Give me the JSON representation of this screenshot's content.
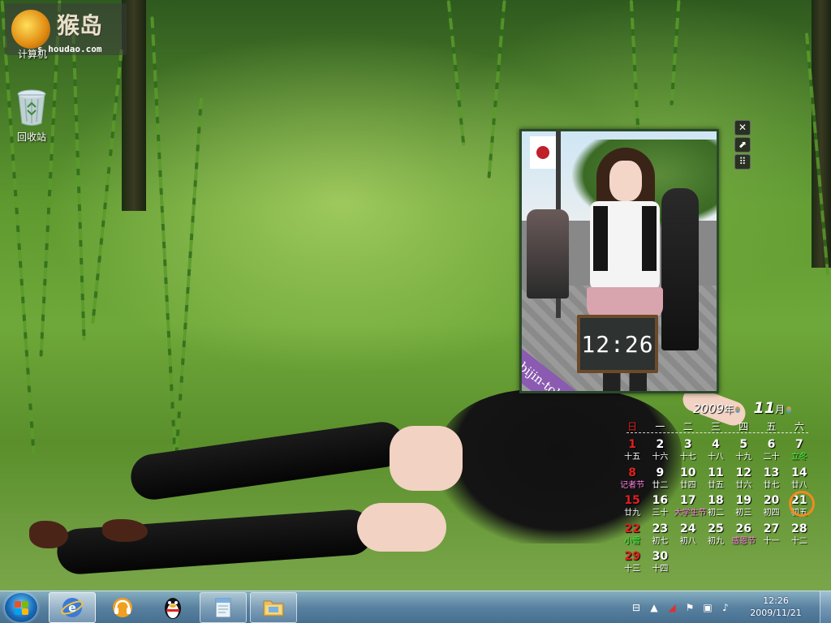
{
  "desktop": {
    "watermark": {
      "logo": "猴岛",
      "url": "s.houdao.com"
    },
    "icons": [
      {
        "label": "计算机",
        "icon": "computer-icon"
      },
      {
        "label": "回收站",
        "icon": "recycle-bin-icon"
      }
    ]
  },
  "bijin_gadget": {
    "time": "12:26",
    "ribbon": "bijin-tokei",
    "tools": {
      "close": "✕",
      "resize": "⬈",
      "drag": "⠿"
    }
  },
  "calendar": {
    "year": "2009",
    "year_suffix": "年",
    "month": "11",
    "month_suffix": "月",
    "weekdays": [
      "日",
      "一",
      "二",
      "三",
      "四",
      "五",
      "六"
    ],
    "today": 21,
    "weeks": [
      [
        {
          "d": "1",
          "l": "十五"
        },
        {
          "d": "2",
          "l": "十六"
        },
        {
          "d": "3",
          "l": "十七"
        },
        {
          "d": "4",
          "l": "十八"
        },
        {
          "d": "5",
          "l": "十九"
        },
        {
          "d": "6",
          "l": "二十"
        },
        {
          "d": "7",
          "l": "立冬",
          "fest": "green"
        }
      ],
      [
        {
          "d": "8",
          "l": "记者节",
          "fest": "pink"
        },
        {
          "d": "9",
          "l": "廿二"
        },
        {
          "d": "10",
          "l": "廿四"
        },
        {
          "d": "11",
          "l": "廿五"
        },
        {
          "d": "12",
          "l": "廿六"
        },
        {
          "d": "13",
          "l": "廿七"
        },
        {
          "d": "14",
          "l": "廿八"
        }
      ],
      [
        {
          "d": "15",
          "l": "廿九"
        },
        {
          "d": "16",
          "l": "三十"
        },
        {
          "d": "17",
          "l": "大学生节",
          "fest": "pink"
        },
        {
          "d": "18",
          "l": "初二"
        },
        {
          "d": "19",
          "l": "初三"
        },
        {
          "d": "20",
          "l": "初四"
        },
        {
          "d": "21",
          "l": "初五"
        }
      ],
      [
        {
          "d": "22",
          "l": "小雪",
          "fest": "green"
        },
        {
          "d": "23",
          "l": "初七"
        },
        {
          "d": "24",
          "l": "初八"
        },
        {
          "d": "25",
          "l": "初九"
        },
        {
          "d": "26",
          "l": "感恩节",
          "fest": "pink"
        },
        {
          "d": "27",
          "l": "十一"
        },
        {
          "d": "28",
          "l": "十二"
        }
      ],
      [
        {
          "d": "29",
          "l": "十三"
        },
        {
          "d": "30",
          "l": "十四"
        },
        {
          "d": "",
          "l": ""
        },
        {
          "d": "",
          "l": ""
        },
        {
          "d": "",
          "l": ""
        },
        {
          "d": "",
          "l": ""
        },
        {
          "d": "",
          "l": ""
        }
      ]
    ]
  },
  "taskbar": {
    "pinned": [
      {
        "name": "ie-button",
        "icon": "internet-explorer-icon"
      },
      {
        "name": "media-player-button",
        "icon": "headphones-player-icon"
      },
      {
        "name": "qq-button",
        "icon": "qq-penguin-icon"
      },
      {
        "name": "notepad-button",
        "icon": "notepad-icon"
      },
      {
        "name": "explorer-button",
        "icon": "folder-icon"
      }
    ],
    "clock": {
      "time": "12:26",
      "date": "2009/11/21"
    }
  },
  "colors": {
    "calendar_today_ring": "#f08a20",
    "sunday_red": "#e02020",
    "ribbon_purple": "#8a5bb0"
  }
}
